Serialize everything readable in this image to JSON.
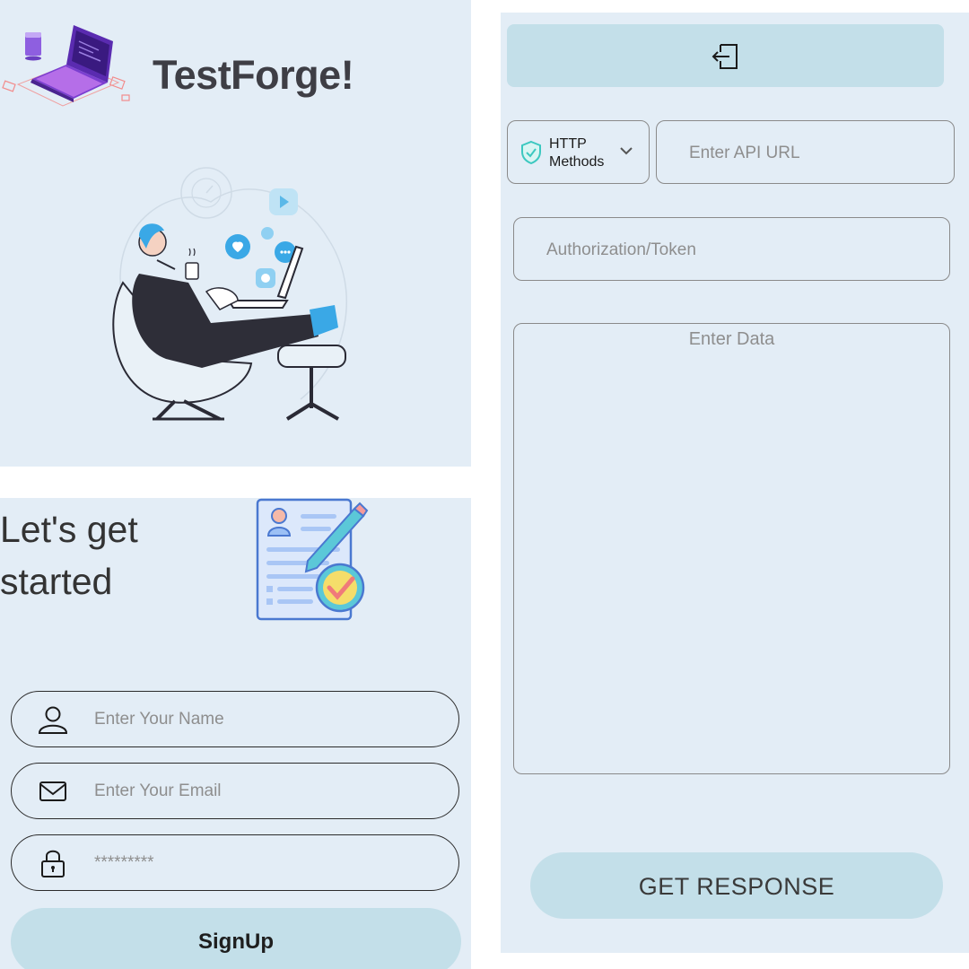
{
  "splash": {
    "app_title": "TestForge!",
    "logo_icon": "laptop-icon",
    "hero_illustration": "developer-lounging-with-laptop"
  },
  "signup": {
    "heading_line1": "Let's get",
    "heading_line2": "started",
    "doc_illustration": "form-checklist-icon",
    "name_field": {
      "icon": "user-icon",
      "placeholder": "Enter Your Name"
    },
    "email_field": {
      "icon": "mail-icon",
      "placeholder": "Enter Your Email"
    },
    "password_field": {
      "icon": "lock-icon",
      "placeholder": "*********"
    },
    "signup_label": "SignUp"
  },
  "api": {
    "top_bar_icon": "logout-icon",
    "methods": {
      "icon": "shield-check-icon",
      "label_line1": "HTTP",
      "label_line2": "Methods",
      "chevron": "chevron-down-icon"
    },
    "url_placeholder": "Enter API URL",
    "auth_placeholder": "Authorization/Token",
    "data_placeholder": "Enter Data",
    "submit_label": "GET RESPONSE"
  },
  "colors": {
    "panel_bg": "#e3edf6",
    "button_bg": "#c3dfe9",
    "title_text": "#3e3e45",
    "placeholder_text": "#8e8e8e",
    "accent_teal": "#3cc8c0"
  }
}
